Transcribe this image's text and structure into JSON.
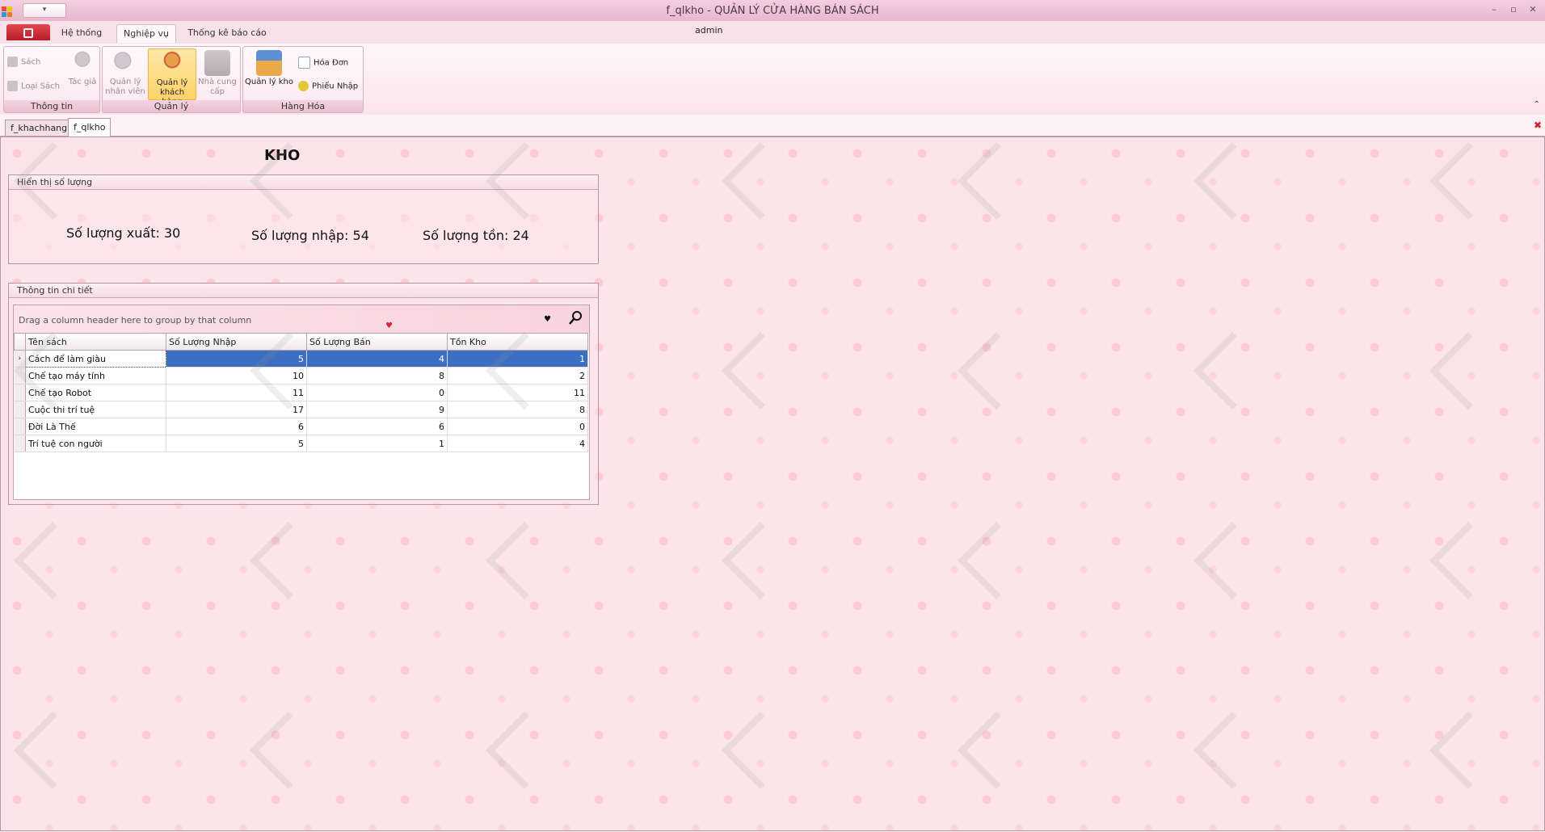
{
  "window": {
    "title": "f_qlkho - QUẢN LÝ CỬA HÀNG BÁN SÁCH",
    "user": "admin",
    "qat_glyph": "▾",
    "controls": [
      "–",
      "▫",
      "✕"
    ]
  },
  "ribbon": {
    "tabs": [
      "Hệ thống",
      "Nghiệp vụ",
      "Thống kê báo cáo"
    ],
    "active_tab": "Nghiệp vụ",
    "groups": {
      "thong_tin": {
        "label": "Thông tin",
        "sach": "Sách",
        "loai_sach": "Loại Sách",
        "tac_gia": "Tác giả"
      },
      "quan_ly": {
        "label": "Quản lý",
        "nhan_vien": "Quản lý nhân viên",
        "khach_hang": "Quản lý khách hàng",
        "nha_cung_cap": "Nhà cung cấp"
      },
      "hang_hoa": {
        "label": "Hàng Hóa",
        "quan_ly_kho": "Quản lý kho",
        "hoa_don": "Hóa Đơn",
        "phieu_nhap": "Phiếu Nhập"
      }
    },
    "collapse_glyph": "⌃"
  },
  "doc_tabs": [
    "f_khachhang",
    "f_qlkho"
  ],
  "active_doc": "f_qlkho",
  "form": {
    "title": "KHO",
    "summary": {
      "header": "Hiển thị số lượng",
      "xuat": "Số lượng xuất: 30",
      "nhap": "Số lượng nhập: 54",
      "ton": "Số lượng tồn: 24"
    },
    "detail": {
      "header": "Thông tin chi tiết",
      "group_hint": "Drag a column header here to group by that column",
      "columns": [
        "Tên sách",
        "Số Lượng Nhập",
        "Số Lượng Bán",
        "Tồn Kho"
      ],
      "rows": [
        [
          "Cách để làm giàu",
          "5",
          "4",
          "1"
        ],
        [
          "Chế tạo máy tính",
          "10",
          "8",
          "2"
        ],
        [
          "Chế tạo Robot",
          "11",
          "0",
          "11"
        ],
        [
          "Cuộc thi trí tuệ",
          "17",
          "9",
          "8"
        ],
        [
          "Đời Là Thế",
          "6",
          "6",
          "0"
        ],
        [
          "Trí tuệ con người",
          "5",
          "1",
          "4"
        ]
      ],
      "selected_row": 0
    }
  },
  "colors": {
    "selection": "#3c6fc2",
    "file_tab": "#c4272f",
    "background": "#fbe5ea"
  }
}
